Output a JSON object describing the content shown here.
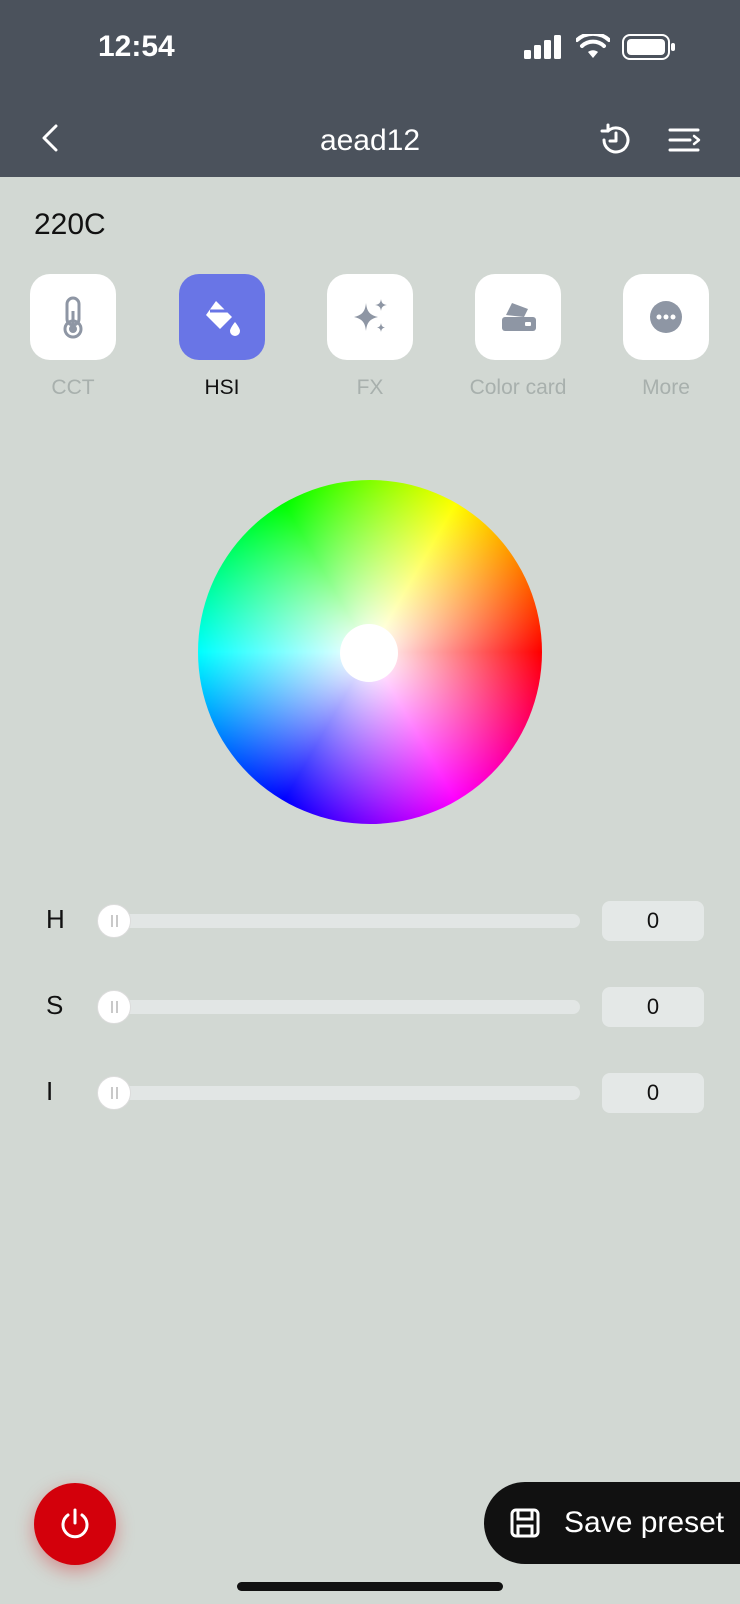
{
  "status_bar": {
    "time": "12:54"
  },
  "nav": {
    "title": "aead12"
  },
  "device": {
    "name": "220C"
  },
  "modes": [
    {
      "label": "CCT",
      "icon": "thermometer-icon",
      "active": false
    },
    {
      "label": "HSI",
      "icon": "paint-bucket-icon",
      "active": true
    },
    {
      "label": "FX",
      "icon": "sparkles-icon",
      "active": false
    },
    {
      "label": "Color card",
      "icon": "color-card-icon",
      "active": false
    },
    {
      "label": "More",
      "icon": "more-icon",
      "active": false
    }
  ],
  "sliders": [
    {
      "label": "H",
      "value": "0"
    },
    {
      "label": "S",
      "value": "0"
    },
    {
      "label": "I",
      "value": "0"
    }
  ],
  "actions": {
    "save_preset": "Save preset"
  },
  "colors": {
    "accent": "#6975e6",
    "power": "#d3000b",
    "header": "#4b525c"
  }
}
